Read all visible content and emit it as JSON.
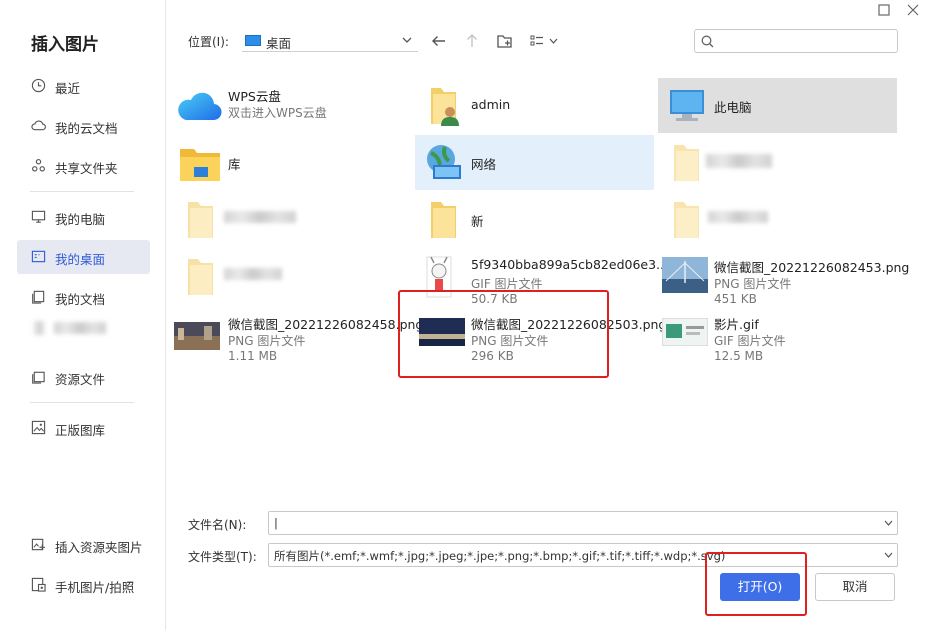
{
  "dialog": {
    "title": "插入图片"
  },
  "window": {
    "maximize_icon": "maximize-icon",
    "close_icon": "close-icon"
  },
  "sidebar": {
    "items": [
      {
        "label": "最近",
        "icon": "clock-icon"
      },
      {
        "label": "我的云文档",
        "icon": "cloud-icon"
      },
      {
        "label": "共享文件夹",
        "icon": "share-icon"
      },
      {
        "label": "我的电脑",
        "icon": "monitor-icon"
      },
      {
        "label": "我的桌面",
        "icon": "desktop-icon",
        "active": true
      },
      {
        "label": "我的文档",
        "icon": "documents-icon"
      },
      {
        "label": "资源文件",
        "icon": "folder-icon"
      },
      {
        "label": "正版图库",
        "icon": "gallery-icon"
      }
    ],
    "bottom_items": [
      {
        "label": "插入资源夹图片",
        "icon": "insert-folder-image-icon"
      },
      {
        "label": "手机图片/拍照",
        "icon": "phone-photo-icon"
      }
    ]
  },
  "toolbar": {
    "location_label": "位置(I):",
    "location_value": "桌面",
    "back_icon": "back-arrow-icon",
    "up_icon": "up-arrow-icon",
    "new_folder_icon": "new-folder-icon",
    "view_icon": "view-mode-icon",
    "search_placeholder": ""
  },
  "files": [
    {
      "name": "WPS云盘",
      "sub1": "双击进入WPS云盘"
    },
    {
      "name": "admin"
    },
    {
      "name": "此电脑"
    },
    {
      "name": "库"
    },
    {
      "name": "网络"
    },
    {
      "name": ""
    },
    {
      "name": ""
    },
    {
      "name": "新"
    },
    {
      "name": ""
    },
    {
      "name": ""
    },
    {
      "name": "5f9340bba899a5cb82ed06e3...",
      "sub1": "GIF 图片文件",
      "sub2": "50.7 KB"
    },
    {
      "name": "微信截图_20221226082453.png",
      "sub1": "PNG 图片文件",
      "sub2": "451 KB"
    },
    {
      "name": "微信截图_20221226082458.png",
      "sub1": "PNG 图片文件",
      "sub2": "1.11 MB"
    },
    {
      "name": "微信截图_20221226082503.png",
      "sub1": "PNG 图片文件",
      "sub2": "296 KB"
    },
    {
      "name": "影片.gif",
      "sub1": "GIF 图片文件",
      "sub2": "12.5 MB"
    }
  ],
  "bottom": {
    "filename_label": "文件名(N):",
    "filename_value": "|",
    "filetype_label": "文件类型(T):",
    "filetype_value": "所有图片(*.emf;*.wmf;*.jpg;*.jpeg;*.jpe;*.png;*.bmp;*.gif;*.tif;*.tiff;*.wdp;*.svg)",
    "open_label": "打开(O)",
    "cancel_label": "取消"
  },
  "colors": {
    "accent": "#3f6fe8",
    "annotation": "#e02020",
    "selected_bg": "#dfdfdf",
    "hover_bg": "#e3f0fc"
  }
}
